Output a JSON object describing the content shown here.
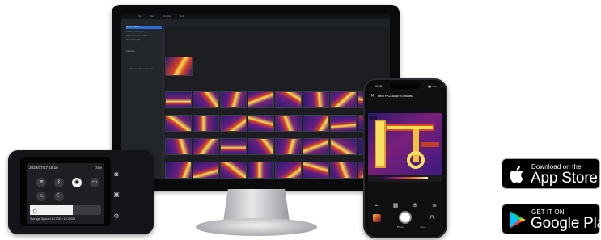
{
  "desktop_app": {
    "menu": [
      "File",
      "View",
      "Analyze",
      "Help"
    ],
    "sidebar": {
      "items": [
        "Pocket2 Album",
        "H1 Pocket2 Images",
        "Pocket2 Images Folder",
        "Recent Imports",
        "Favorites",
        "Device"
      ],
      "footer": "Photo: 1 / Videos: 0 / Files"
    },
    "toolbar": [
      "Import",
      "Export",
      "Report"
    ]
  },
  "camera": {
    "date": "2023/07/17 16:16",
    "battery": "78%",
    "storage": "Storage Space:11.17GB / 15.28GB",
    "icons": [
      "wifi-icon",
      "bluetooth-icon",
      "hotspot-icon",
      "home-icon",
      "moon-icon",
      "screen-icon"
    ],
    "brightness_level": 0.6
  },
  "phone": {
    "time": "19:16",
    "title": "HM-TPK2-3AQEW-Pocket2",
    "photo_label": "Photo",
    "video_label": "Video"
  },
  "badges": {
    "appstore": {
      "small": "Download on the",
      "big": "App Store"
    },
    "googleplay": {
      "small": "GET IT ON",
      "big": "Google Play"
    }
  },
  "colors": {
    "badge_bg": "#000000",
    "thermal_hot": "#f5e04a",
    "thermal_mid": "#d8402a",
    "thermal_cold": "#2a1b6e"
  }
}
